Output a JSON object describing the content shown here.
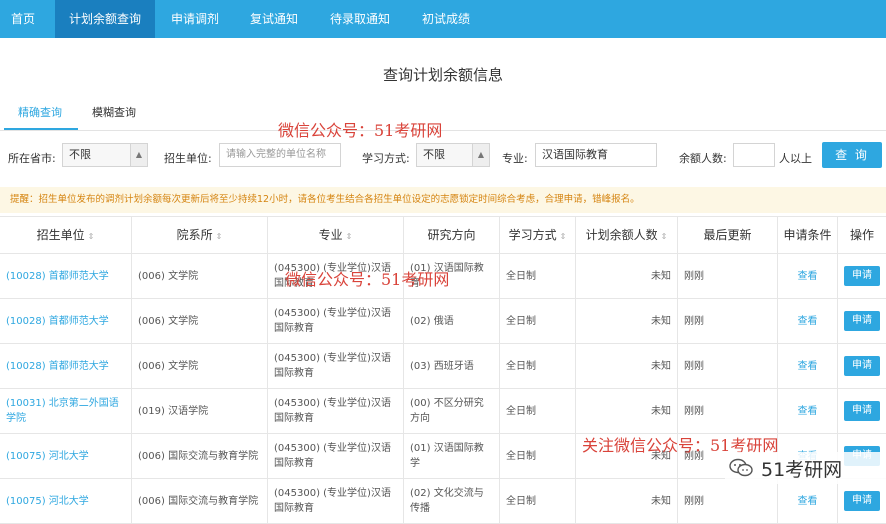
{
  "nav": {
    "items": [
      {
        "label": "首页",
        "active": false
      },
      {
        "label": "计划余额查询",
        "active": true
      },
      {
        "label": "申请调剂",
        "active": false
      },
      {
        "label": "复试通知",
        "active": false
      },
      {
        "label": "待录取通知",
        "active": false
      },
      {
        "label": "初试成绩",
        "active": false
      }
    ]
  },
  "page_title": "查询计划余额信息",
  "tabs": [
    {
      "label": "精确查询",
      "active": true
    },
    {
      "label": "模糊查询",
      "active": false
    }
  ],
  "filters": {
    "province_label": "所在省市:",
    "province_value": "不限",
    "unit_label": "招生单位:",
    "unit_placeholder": "请输入完整的单位名称",
    "mode_label": "学习方式:",
    "mode_value": "不限",
    "major_label": "专业:",
    "major_value": "汉语国际教育",
    "remain_label": "余额人数:",
    "remain_value": "",
    "remain_suffix": "人以上",
    "search_label": "查 询"
  },
  "notice": "提醒：招生单位发布的调剂计划余额每次更新后将至少持续12小时，请各位考生结合各招生单位设定的志愿锁定时间综合考虑，合理申请，错峰报名。",
  "table": {
    "columns": [
      {
        "label": "招生单位",
        "sortable": true
      },
      {
        "label": "院系所",
        "sortable": true
      },
      {
        "label": "专业",
        "sortable": true
      },
      {
        "label": "研究方向",
        "sortable": false
      },
      {
        "label": "学习方式",
        "sortable": true
      },
      {
        "label": "计划余额人数",
        "sortable": true
      },
      {
        "label": "最后更新",
        "sortable": false
      },
      {
        "label": "申请条件",
        "sortable": false
      },
      {
        "label": "操作",
        "sortable": false
      }
    ],
    "rows": [
      {
        "unit": "(10028) 首都师范大学",
        "dept": "(006) 文学院",
        "major": "(045300) (专业学位)汉语国际教育",
        "direction": "(01) 汉语国际教育",
        "mode": "全日制",
        "remain": "未知",
        "updated": "刚刚",
        "cond": "查看",
        "action": "申请"
      },
      {
        "unit": "(10028) 首都师范大学",
        "dept": "(006) 文学院",
        "major": "(045300) (专业学位)汉语国际教育",
        "direction": "(02) 俄语",
        "mode": "全日制",
        "remain": "未知",
        "updated": "刚刚",
        "cond": "查看",
        "action": "申请"
      },
      {
        "unit": "(10028) 首都师范大学",
        "dept": "(006) 文学院",
        "major": "(045300) (专业学位)汉语国际教育",
        "direction": "(03) 西班牙语",
        "mode": "全日制",
        "remain": "未知",
        "updated": "刚刚",
        "cond": "查看",
        "action": "申请"
      },
      {
        "unit": "(10031) 北京第二外国语学院",
        "dept": "(019) 汉语学院",
        "major": "(045300) (专业学位)汉语国际教育",
        "direction": "(00) 不区分研究方向",
        "mode": "全日制",
        "remain": "未知",
        "updated": "刚刚",
        "cond": "查看",
        "action": "申请"
      },
      {
        "unit": "(10075) 河北大学",
        "dept": "(006) 国际交流与教育学院",
        "major": "(045300) (专业学位)汉语国际教育",
        "direction": "(01) 汉语国际教学",
        "mode": "全日制",
        "remain": "未知",
        "updated": "刚刚",
        "cond": "查看",
        "action": "申请"
      },
      {
        "unit": "(10075) 河北大学",
        "dept": "(006) 国际交流与教育学院",
        "major": "(045300) (专业学位)汉语国际教育",
        "direction": "(02) 文化交流与传播",
        "mode": "全日制",
        "remain": "未知",
        "updated": "刚刚",
        "cond": "查看",
        "action": "申请"
      }
    ]
  },
  "watermarks": {
    "w1": "微信公众号：51考研网",
    "w2": "微信公众号：51考研网",
    "w3": "关注微信公众号：51考研网",
    "logo_text": "51考研网"
  },
  "colors": {
    "primary": "#2ea7e0",
    "nav_active": "#1a7fbf",
    "notice_bg": "#fdf7e4",
    "notice_text": "#d58512",
    "watermark": "#d9433a"
  }
}
